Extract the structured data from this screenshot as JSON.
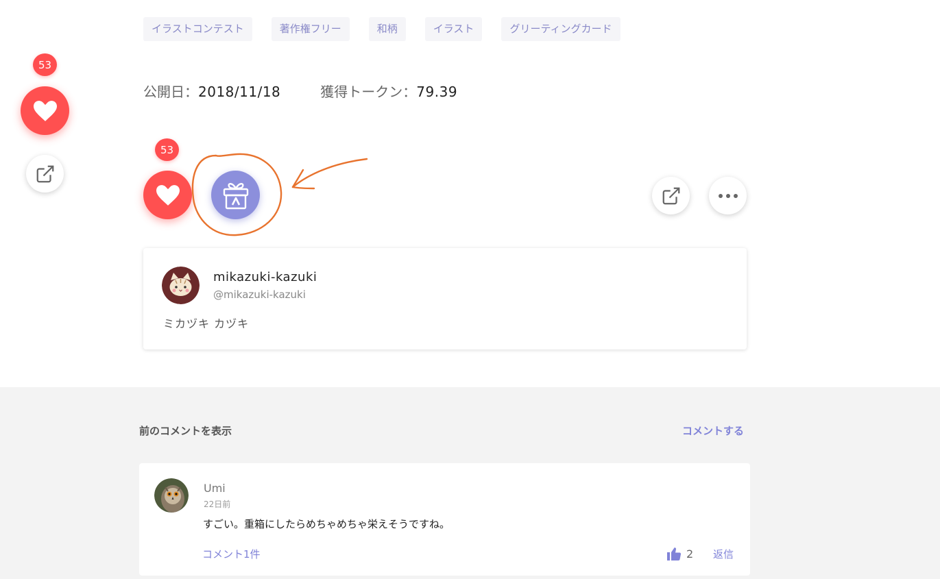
{
  "tags": [
    "イラストコンテスト",
    "著作権フリー",
    "和柄",
    "イラスト",
    "グリーティングカード"
  ],
  "meta": {
    "published_label": "公開日：",
    "published_value": "2018/11/18",
    "tokens_label": "獲得トークン：",
    "tokens_value": "79.39"
  },
  "side": {
    "like_count": "53"
  },
  "actions": {
    "like_count": "53"
  },
  "author": {
    "name": "mikazuki-kazuki",
    "handle": "@mikazuki-kazuki",
    "bio": "ミカヅキ カヅキ"
  },
  "comments": {
    "prev_label": "前のコメントを表示",
    "write_label": "コメントする",
    "items": [
      {
        "user": "Umi",
        "time": "22日前",
        "body": "すごい。重箱にしたらめちゃめちゃ栄えそうですね。",
        "replies_label": "コメント1件",
        "likes": "2",
        "reply_label": "返信"
      }
    ]
  },
  "colors": {
    "like_red": "#ff5050",
    "tip_purple": "#8c8fdc",
    "link_purple": "#8083d8",
    "annotation_orange": "#e8732e"
  },
  "icons": {
    "like": "heart-icon",
    "tip": "gift-icon",
    "share": "external-link-icon",
    "more": "more-dots-icon",
    "thumb": "thumbs-up-icon"
  }
}
